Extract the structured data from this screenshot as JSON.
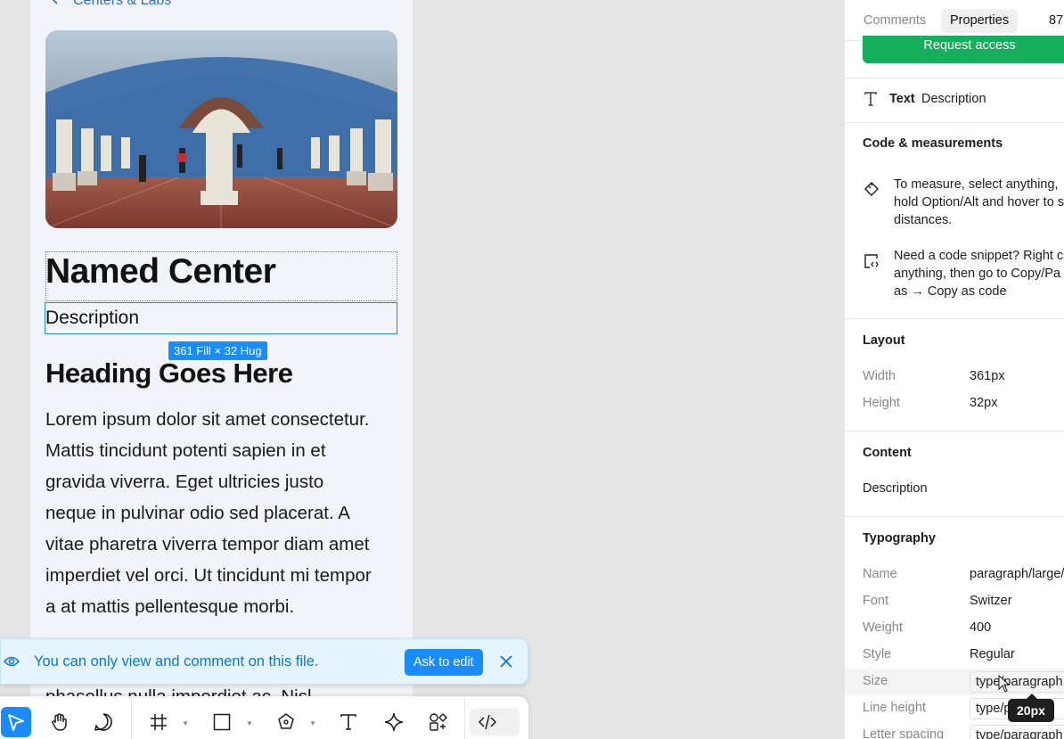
{
  "canvas": {
    "back_link": "Centers & Labs",
    "title": "Named Center",
    "description": "Description",
    "size_badge": "361 Fill × 32 Hug",
    "heading": "Heading Goes Here",
    "paragraph_lines": [
      "Lorem ipsum dolor sit amet consectetur.",
      "Mattis tincidunt potenti sapien in et",
      "gravida viverra. Eget ultricies justo",
      "neque in pulvinar odio sed placerat. A",
      "vitae pharetra viverra tempor diam amet",
      "imperdiet vel orci. Ut tincidunt mi tempor",
      "a at mattis pellentesque morbi."
    ],
    "cutoff_text": "phasellus nulla imperdiet ac. Nisl"
  },
  "banner": {
    "message": "You can only view and comment on this file.",
    "ask_label": "Ask to edit"
  },
  "toolbar": {
    "tools": [
      "move-icon",
      "hand-icon",
      "comment-icon",
      "frame-icon",
      "rectangle-icon",
      "pen-icon",
      "text-icon",
      "component-icon",
      "actions-icon",
      "dev-mode-icon"
    ]
  },
  "panel": {
    "tabs": {
      "comments": "Comments",
      "properties": "Properties",
      "zoom": "87"
    },
    "request_access": "Request access",
    "layer": {
      "type": "Text",
      "name": "Description"
    },
    "code": {
      "heading": "Code & measurements",
      "measure_lines": [
        "To measure, select anything,",
        "hold Option/Alt and hover to s",
        "distances."
      ],
      "snippet_lines": [
        "Need a code snippet? Right c",
        "anything, then go to Copy/Pa",
        "as → Copy as code"
      ]
    },
    "layout": {
      "heading": "Layout",
      "width_label": "Width",
      "width_value": "361px",
      "height_label": "Height",
      "height_value": "32px"
    },
    "content": {
      "heading": "Content",
      "value": "Description"
    },
    "typography": {
      "heading": "Typography",
      "name_label": "Name",
      "name_value": "paragraph/large/",
      "font_label": "Font",
      "font_value": "Switzer",
      "weight_label": "Weight",
      "weight_value": "400",
      "style_label": "Style",
      "style_value": "Regular",
      "size_label": "Size",
      "size_value": "type/paragraph",
      "lineheight_label": "Line height",
      "lineheight_value": "type/p",
      "letterspacing_label": "Letter spacing",
      "letterspacing_value": "type/paragraph"
    },
    "tooltip": "20px"
  },
  "colors": {
    "accent": "#1a8cff",
    "success": "#14ae5c",
    "banner_bg": "#e5f4ff"
  }
}
